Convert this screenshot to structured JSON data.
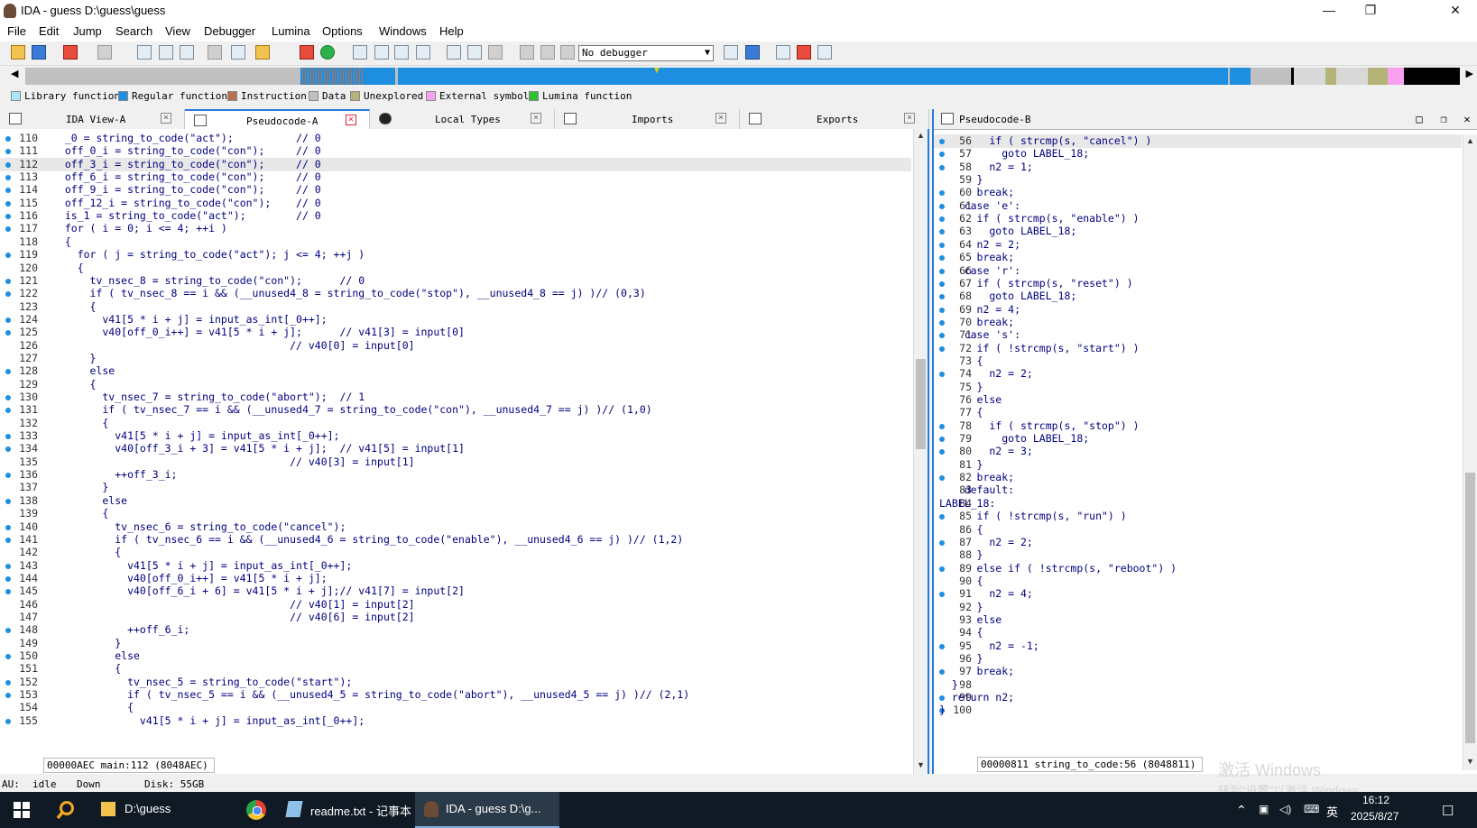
{
  "window": {
    "title": "IDA - guess D:\\guess\\guess",
    "minimize": "—",
    "maximize": "❐",
    "close": "✕"
  },
  "menu": [
    "File",
    "Edit",
    "Jump",
    "Search",
    "View",
    "Debugger",
    "Lumina",
    "Options",
    "Windows",
    "Help"
  ],
  "toolbar": {
    "debugger": "No debugger"
  },
  "legend": [
    {
      "label": "Library function",
      "color": "#a8e8f8"
    },
    {
      "label": "Regular function",
      "color": "#1e8ee0"
    },
    {
      "label": "Instruction",
      "color": "#b87050"
    },
    {
      "label": "Data",
      "color": "#c0c0c0"
    },
    {
      "label": "Unexplored",
      "color": "#b4b478"
    },
    {
      "label": "External symbol",
      "color": "#f8a0f0"
    },
    {
      "label": "Lumina function",
      "color": "#30c030"
    }
  ],
  "tabs": [
    {
      "label": "IDA View-A",
      "active": false
    },
    {
      "label": "Pseudocode-A",
      "active": true
    },
    {
      "label": "Local Types",
      "active": false
    },
    {
      "label": "Imports",
      "active": false
    },
    {
      "label": "Exports",
      "active": false
    }
  ],
  "pseudocodeA": {
    "status": "00000AEC main:112 (8048AEC)",
    "lines": [
      {
        "n": "110",
        "t": "  _0 = string_to_code(\"act\");          // 0"
      },
      {
        "n": "111",
        "t": "  off_0_i = string_to_code(\"con\");     // 0"
      },
      {
        "n": "112",
        "t": "  off_3_i = string_to_code(\"con\");     // 0"
      },
      {
        "n": "113",
        "t": "  off_6_i = string_to_code(\"con\");     // 0"
      },
      {
        "n": "114",
        "t": "  off_9_i = string_to_code(\"con\");     // 0"
      },
      {
        "n": "115",
        "t": "  off_12_i = string_to_code(\"con\");    // 0"
      },
      {
        "n": "116",
        "t": "  is_1 = string_to_code(\"act\");        // 0"
      },
      {
        "n": "117",
        "t": "  for ( i = 0; i <= 4; ++i )"
      },
      {
        "n": "118",
        "t": "  {"
      },
      {
        "n": "119",
        "t": "    for ( j = string_to_code(\"act\"); j <= 4; ++j )"
      },
      {
        "n": "120",
        "t": "    {"
      },
      {
        "n": "121",
        "t": "      tv_nsec_8 = string_to_code(\"con\");      // 0"
      },
      {
        "n": "122",
        "t": "      if ( tv_nsec_8 == i && (__unused4_8 = string_to_code(\"stop\"), __unused4_8 == j) )// (0,3)"
      },
      {
        "n": "123",
        "t": "      {"
      },
      {
        "n": "124",
        "t": "        v41[5 * i + j] = input_as_int[_0++];"
      },
      {
        "n": "125",
        "t": "        v40[off_0_i++] = v41[5 * i + j];      // v41[3] = input[0]"
      },
      {
        "n": "126",
        "t": "                                      // v40[0] = input[0]"
      },
      {
        "n": "127",
        "t": "      }"
      },
      {
        "n": "128",
        "t": "      else"
      },
      {
        "n": "129",
        "t": "      {"
      },
      {
        "n": "130",
        "t": "        tv_nsec_7 = string_to_code(\"abort\");  // 1"
      },
      {
        "n": "131",
        "t": "        if ( tv_nsec_7 == i && (__unused4_7 = string_to_code(\"con\"), __unused4_7 == j) )// (1,0)"
      },
      {
        "n": "132",
        "t": "        {"
      },
      {
        "n": "133",
        "t": "          v41[5 * i + j] = input_as_int[_0++];"
      },
      {
        "n": "134",
        "t": "          v40[off_3_i + 3] = v41[5 * i + j];  // v41[5] = input[1]"
      },
      {
        "n": "135",
        "t": "                                      // v40[3] = input[1]"
      },
      {
        "n": "136",
        "t": "          ++off_3_i;"
      },
      {
        "n": "137",
        "t": "        }"
      },
      {
        "n": "138",
        "t": "        else"
      },
      {
        "n": "139",
        "t": "        {"
      },
      {
        "n": "140",
        "t": "          tv_nsec_6 = string_to_code(\"cancel\");"
      },
      {
        "n": "141",
        "t": "          if ( tv_nsec_6 == i && (__unused4_6 = string_to_code(\"enable\"), __unused4_6 == j) )// (1,2)"
      },
      {
        "n": "142",
        "t": "          {"
      },
      {
        "n": "143",
        "t": "            v41[5 * i + j] = input_as_int[_0++];"
      },
      {
        "n": "144",
        "t": "            v40[off_0_i++] = v41[5 * i + j];"
      },
      {
        "n": "145",
        "t": "            v40[off_6_i + 6] = v41[5 * i + j];// v41[7] = input[2]"
      },
      {
        "n": "146",
        "t": "                                      // v40[1] = input[2]"
      },
      {
        "n": "147",
        "t": "                                      // v40[6] = input[2]"
      },
      {
        "n": "148",
        "t": "            ++off_6_i;"
      },
      {
        "n": "149",
        "t": "          }"
      },
      {
        "n": "150",
        "t": "          else"
      },
      {
        "n": "151",
        "t": "          {"
      },
      {
        "n": "152",
        "t": "            tv_nsec_5 = string_to_code(\"start\");"
      },
      {
        "n": "153",
        "t": "            if ( tv_nsec_5 == i && (__unused4_5 = string_to_code(\"abort\"), __unused4_5 == j) )// (2,1)"
      },
      {
        "n": "154",
        "t": "            {"
      },
      {
        "n": "155",
        "t": "              v41[5 * i + j] = input_as_int[_0++];"
      }
    ]
  },
  "pseudocodeB": {
    "title": "Pseudocode-B",
    "status": "00000811 string_to_code:56 (8048811)",
    "lines": [
      {
        "n": "56",
        "t": "        if ( strcmp(s, \"cancel\") )"
      },
      {
        "n": "57",
        "t": "          goto LABEL_18;"
      },
      {
        "n": "58",
        "t": "        n2 = 1;"
      },
      {
        "n": "59",
        "t": "      }"
      },
      {
        "n": "60",
        "t": "      break;"
      },
      {
        "n": "61",
        "t": "    case 'e':"
      },
      {
        "n": "62",
        "t": "      if ( strcmp(s, \"enable\") )"
      },
      {
        "n": "63",
        "t": "        goto LABEL_18;"
      },
      {
        "n": "64",
        "t": "      n2 = 2;"
      },
      {
        "n": "65",
        "t": "      break;"
      },
      {
        "n": "66",
        "t": "    case 'r':"
      },
      {
        "n": "67",
        "t": "      if ( strcmp(s, \"reset\") )"
      },
      {
        "n": "68",
        "t": "        goto LABEL_18;"
      },
      {
        "n": "69",
        "t": "      n2 = 4;"
      },
      {
        "n": "70",
        "t": "      break;"
      },
      {
        "n": "71",
        "t": "    case 's':"
      },
      {
        "n": "72",
        "t": "      if ( !strcmp(s, \"start\") )"
      },
      {
        "n": "73",
        "t": "      {"
      },
      {
        "n": "74",
        "t": "        n2 = 2;"
      },
      {
        "n": "75",
        "t": "      }"
      },
      {
        "n": "76",
        "t": "      else"
      },
      {
        "n": "77",
        "t": "      {"
      },
      {
        "n": "78",
        "t": "        if ( strcmp(s, \"stop\") )"
      },
      {
        "n": "79",
        "t": "          goto LABEL_18;"
      },
      {
        "n": "80",
        "t": "        n2 = 3;"
      },
      {
        "n": "81",
        "t": "      }"
      },
      {
        "n": "82",
        "t": "      break;"
      },
      {
        "n": "83",
        "t": "    default:"
      },
      {
        "n": "84",
        "t": "LABEL_18:"
      },
      {
        "n": "85",
        "t": "      if ( !strcmp(s, \"run\") )"
      },
      {
        "n": "86",
        "t": "      {"
      },
      {
        "n": "87",
        "t": "        n2 = 2;"
      },
      {
        "n": "88",
        "t": "      }"
      },
      {
        "n": "89",
        "t": "      else if ( !strcmp(s, \"reboot\") )"
      },
      {
        "n": "90",
        "t": "      {"
      },
      {
        "n": "91",
        "t": "        n2 = 4;"
      },
      {
        "n": "92",
        "t": "      }"
      },
      {
        "n": "93",
        "t": "      else"
      },
      {
        "n": "94",
        "t": "      {"
      },
      {
        "n": "95",
        "t": "        n2 = -1;"
      },
      {
        "n": "96",
        "t": "      }"
      },
      {
        "n": "97",
        "t": "      break;"
      },
      {
        "n": "98",
        "t": "  }"
      },
      {
        "n": "99",
        "t": "  return n2;"
      },
      {
        "n": "100",
        "t": "}"
      }
    ]
  },
  "status": {
    "au": "AU:",
    "state": "idle",
    "dir": "Down",
    "disk": "Disk: 55GB"
  },
  "taskbar": {
    "items": [
      {
        "label": "D:\\guess"
      },
      {
        "label": "readme.txt - 记事本"
      },
      {
        "label": "IDA - guess D:\\g..."
      }
    ],
    "ime": "英",
    "time": "16:12",
    "date": "2025/8/27"
  },
  "watermark": [
    "激活 Windows",
    "转到\"设置\"以激活 Windows。"
  ]
}
